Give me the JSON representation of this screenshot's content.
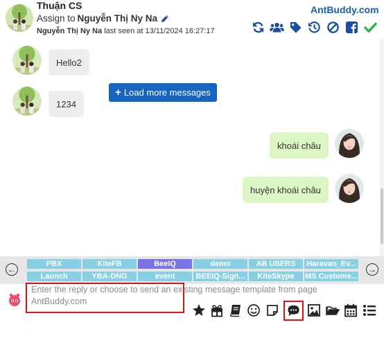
{
  "header": {
    "contact_name": "Thuận CS",
    "assign_prefix": "Assign to",
    "assignee": "Nguyễn Thị Ny Na",
    "last_seen_name": "Nguyễn Thị Ny Na",
    "last_seen_text": "last seen at 13/11/2024 16:27:17",
    "brand": "AntBuddy.com",
    "icons": [
      "refresh-icon",
      "group-icon",
      "tag-icon",
      "history-icon",
      "block-icon",
      "facebook-icon",
      "check-icon"
    ],
    "brand_color": "#1a5fb4"
  },
  "chat": {
    "load_more_label": "Load more messages",
    "messages": [
      {
        "direction": "in",
        "text": "Hello2"
      },
      {
        "direction": "in",
        "text": "1234"
      },
      {
        "direction": "out",
        "text": "khoái châu"
      },
      {
        "direction": "out",
        "text": "huyện khoái châu"
      }
    ]
  },
  "templates": {
    "tags": [
      [
        "PBX",
        "KiteFB",
        "BeeIQ",
        "demo",
        "AB USERS",
        "Haravan_Ev..."
      ],
      [
        "Launch",
        "YBA-DNG",
        "event",
        "BEEIQ-Sign...",
        "KiteSkype",
        "MS Custome..."
      ]
    ],
    "active_tag": "BeeIQ",
    "tag_color": "#87cfe3",
    "active_tag_color": "#7b74e8"
  },
  "composer": {
    "placeholder": "Enter the reply or choose to send an existing message template from page AntBuddy.com",
    "icons": [
      "star-icon",
      "gift-icon",
      "book-icon",
      "smile-icon",
      "note-icon",
      "comment-icon",
      "image-icon",
      "folder-icon",
      "calendar-icon",
      "list-icon"
    ],
    "highlighted_icon": "comment-icon"
  }
}
